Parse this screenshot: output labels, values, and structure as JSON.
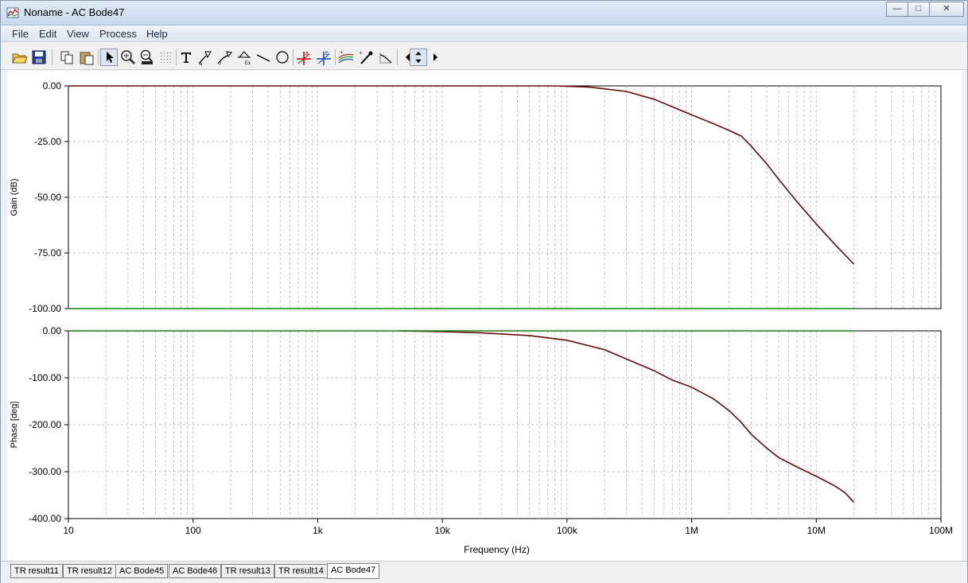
{
  "window": {
    "title": "Noname - AC Bode47",
    "buttons": {
      "minimize": "—",
      "maximize": "□",
      "close": "✕"
    }
  },
  "menu": [
    "File",
    "Edit",
    "View",
    "Process",
    "Help"
  ],
  "toolbar_icons": [
    "open-icon",
    "save-icon",
    "copy-icon",
    "paste-icon",
    "pointer-icon",
    "zoom-in-icon",
    "zoom-100-icon",
    "grid-icon",
    "text-icon",
    "label-icon",
    "label-curve-icon",
    "label-y-icon",
    "line-icon",
    "circle-icon",
    "cursor-a-icon",
    "cursor-b-icon",
    "curves-icon",
    "pick-icon",
    "tangent-icon",
    "arrow-left-icon",
    "arrow-updown-icon",
    "arrow-right-icon"
  ],
  "tabs": [
    "TR result11",
    "TR result12",
    "AC Bode45",
    "AC Bode46",
    "TR result13",
    "TR result14",
    "AC Bode47"
  ],
  "active_tab": 6,
  "colors": {
    "trace": "#6b0a0a",
    "reference": "#108a10",
    "grid": "#b4b4b4"
  },
  "chart_data": [
    {
      "type": "line",
      "ylabel": "Gain (dB)",
      "xscale": "log",
      "xlim": [
        10,
        100000000
      ],
      "ylim": [
        -100,
        0
      ],
      "yticks": [
        0,
        -25,
        -50,
        -75,
        -100
      ],
      "ytick_labels": [
        "0.00",
        "-25.00",
        "-50.00",
        "-75.00",
        "-100.00"
      ],
      "grid": true,
      "series": [
        {
          "x": [
            10,
            1000,
            10000,
            80000,
            150000,
            300000,
            500000,
            1000000,
            1500000,
            2000000,
            2500000,
            3000000,
            4000000,
            5000000,
            7000000,
            10000000,
            14000000,
            20000000
          ],
          "y": [
            0,
            0,
            0,
            0,
            -0.5,
            -2.5,
            -6,
            -13,
            -17,
            -20,
            -22.5,
            -27,
            -35,
            -42,
            -52,
            -62,
            -71,
            -80
          ]
        },
        {
          "x": [
            10,
            20000000
          ],
          "y": [
            -100,
            -100
          ]
        },
        {
          "x": [
            20000000,
            100000000
          ],
          "y": [
            -100,
            -100
          ]
        }
      ]
    },
    {
      "type": "line",
      "ylabel": "Phase [deg]",
      "xlabel": "Frequency (Hz)",
      "xscale": "log",
      "xlim": [
        10,
        100000000
      ],
      "ylim": [
        -400,
        0
      ],
      "yticks": [
        0,
        -100,
        -200,
        -300,
        -400
      ],
      "ytick_labels": [
        "0.00",
        "-100.00",
        "-200.00",
        "-300.00",
        "-400.00"
      ],
      "xticks": [
        10,
        100,
        1000,
        10000,
        100000,
        1000000,
        10000000,
        100000000
      ],
      "xtick_labels": [
        "10",
        "100",
        "1k",
        "10k",
        "100k",
        "1M",
        "10M",
        "100M"
      ],
      "grid": true,
      "series": [
        {
          "x": [
            4500,
            10000,
            20000,
            50000,
            100000,
            200000,
            300000,
            500000,
            700000,
            1000000,
            1500000,
            2000000,
            2500000,
            3000000,
            4000000,
            5000000,
            7000000,
            10000000,
            14000000,
            17000000,
            20000000
          ],
          "y": [
            0,
            -1.5,
            -4,
            -10,
            -20,
            -40,
            -60,
            -85,
            -105,
            -120,
            -145,
            -170,
            -195,
            -220,
            -250,
            -270,
            -290,
            -310,
            -330,
            -345,
            -365
          ]
        },
        {
          "x": [
            10,
            20000000
          ],
          "y": [
            0,
            0
          ]
        }
      ]
    }
  ]
}
